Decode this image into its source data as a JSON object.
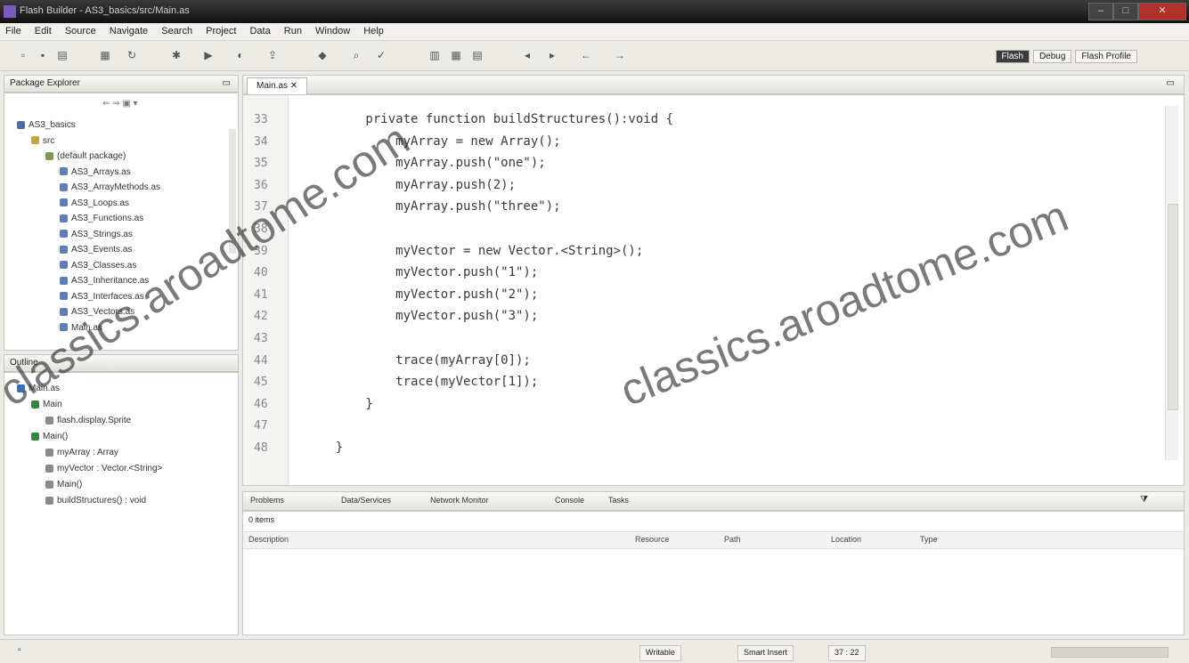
{
  "window": {
    "title": "Flash Builder - AS3_basics/src/Main.as"
  },
  "menu": [
    "File",
    "Edit",
    "Source",
    "Navigate",
    "Search",
    "Project",
    "Data",
    "Run",
    "Window",
    "Help"
  ],
  "perspectives": {
    "flash": "Flash",
    "debug": "Debug",
    "profile": "Flash Profile"
  },
  "package_explorer": {
    "title": "Package Explorer",
    "tree": [
      {
        "label": "AS3_basics",
        "level": 0
      },
      {
        "label": "src",
        "level": 1
      },
      {
        "label": "(default package)",
        "level": 2
      },
      {
        "label": "AS3_Arrays.as",
        "level": 3
      },
      {
        "label": "AS3_ArrayMethods.as",
        "level": 3
      },
      {
        "label": "AS3_Loops.as",
        "level": 3
      },
      {
        "label": "AS3_Functions.as",
        "level": 3
      },
      {
        "label": "AS3_Strings.as",
        "level": 3
      },
      {
        "label": "AS3_Events.as",
        "level": 3
      },
      {
        "label": "AS3_Classes.as",
        "level": 3
      },
      {
        "label": "AS3_Inheritance.as",
        "level": 3
      },
      {
        "label": "AS3_Interfaces.as",
        "level": 3
      },
      {
        "label": "AS3_Vectors.as",
        "level": 3
      },
      {
        "label": "Main.as",
        "level": 3
      }
    ]
  },
  "outline": {
    "title": "Outline",
    "tree": [
      {
        "label": "Main.as",
        "level": 0
      },
      {
        "label": "Main",
        "level": 1
      },
      {
        "label": "flash.display.Sprite",
        "level": 2
      },
      {
        "label": "Main()",
        "level": 1
      },
      {
        "label": "myArray : Array",
        "level": 2
      },
      {
        "label": "myVector : Vector.<String>",
        "level": 2
      },
      {
        "label": "Main()",
        "level": 2
      },
      {
        "label": "buildStructures() : void",
        "level": 2
      }
    ]
  },
  "editor": {
    "tab": "Main.as",
    "lines": [
      {
        "num": "33",
        "text": "        private function buildStructures():void {"
      },
      {
        "num": "34",
        "text": "            myArray = new Array();"
      },
      {
        "num": "35",
        "text": "            myArray.push(\"one\");"
      },
      {
        "num": "36",
        "text": "            myArray.push(2);"
      },
      {
        "num": "37",
        "text": "            myArray.push(\"three\");"
      },
      {
        "num": "38",
        "text": ""
      },
      {
        "num": "39",
        "text": "            myVector = new Vector.<String>();"
      },
      {
        "num": "40",
        "text": "            myVector.push(\"1\");"
      },
      {
        "num": "41",
        "text": "            myVector.push(\"2\");"
      },
      {
        "num": "42",
        "text": "            myVector.push(\"3\");"
      },
      {
        "num": "43",
        "text": ""
      },
      {
        "num": "44",
        "text": "            trace(myArray[0]);"
      },
      {
        "num": "45",
        "text": "            trace(myVector[1]);"
      },
      {
        "num": "46",
        "text": "        }"
      },
      {
        "num": "47",
        "text": ""
      },
      {
        "num": "48",
        "text": "    }"
      }
    ]
  },
  "bottom_panel": {
    "tabs": [
      "Problems",
      "Data/Services",
      "Network Monitor",
      "Console",
      "Tasks"
    ],
    "items_label": "0 items",
    "columns": [
      "Description",
      "Resource",
      "Path",
      "Location",
      "Type"
    ]
  },
  "status": {
    "insert_mode": "Writable",
    "smart_insert": "Smart Insert",
    "position": "37 : 22"
  },
  "watermarks": [
    "classics.aroadtome.com",
    "classics.aroadtome.com"
  ]
}
